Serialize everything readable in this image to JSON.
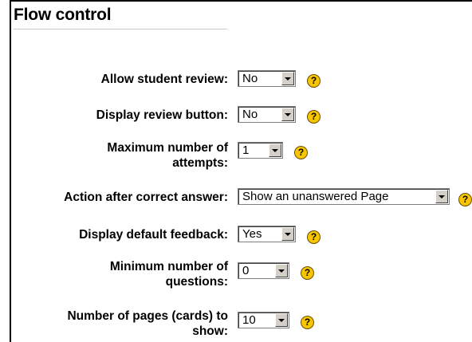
{
  "section": {
    "title": "Flow control"
  },
  "fields": [
    {
      "label": [
        "Allow student review:"
      ],
      "value": "No",
      "help": "?"
    },
    {
      "label": [
        "Display review button:"
      ],
      "value": "No",
      "help": "?"
    },
    {
      "label": [
        "Maximum number of",
        "attempts:"
      ],
      "value": "1",
      "help": "?"
    },
    {
      "label": [
        "Action after correct answer:"
      ],
      "value": "Show an unanswered Page",
      "help": "?"
    },
    {
      "label": [
        "Display default feedback:"
      ],
      "value": "Yes",
      "help": "?"
    },
    {
      "label": [
        "Minimum number of",
        "questions:"
      ],
      "value": "0",
      "help": "?"
    },
    {
      "label": [
        "Number of pages (cards) to",
        "show:"
      ],
      "value": "10",
      "help": "?"
    }
  ],
  "icons": {
    "help": "help-question-icon",
    "dropdown": "chevron-down-icon"
  },
  "colors": {
    "help_icon": "#f7c600",
    "background": "#ffffff"
  }
}
